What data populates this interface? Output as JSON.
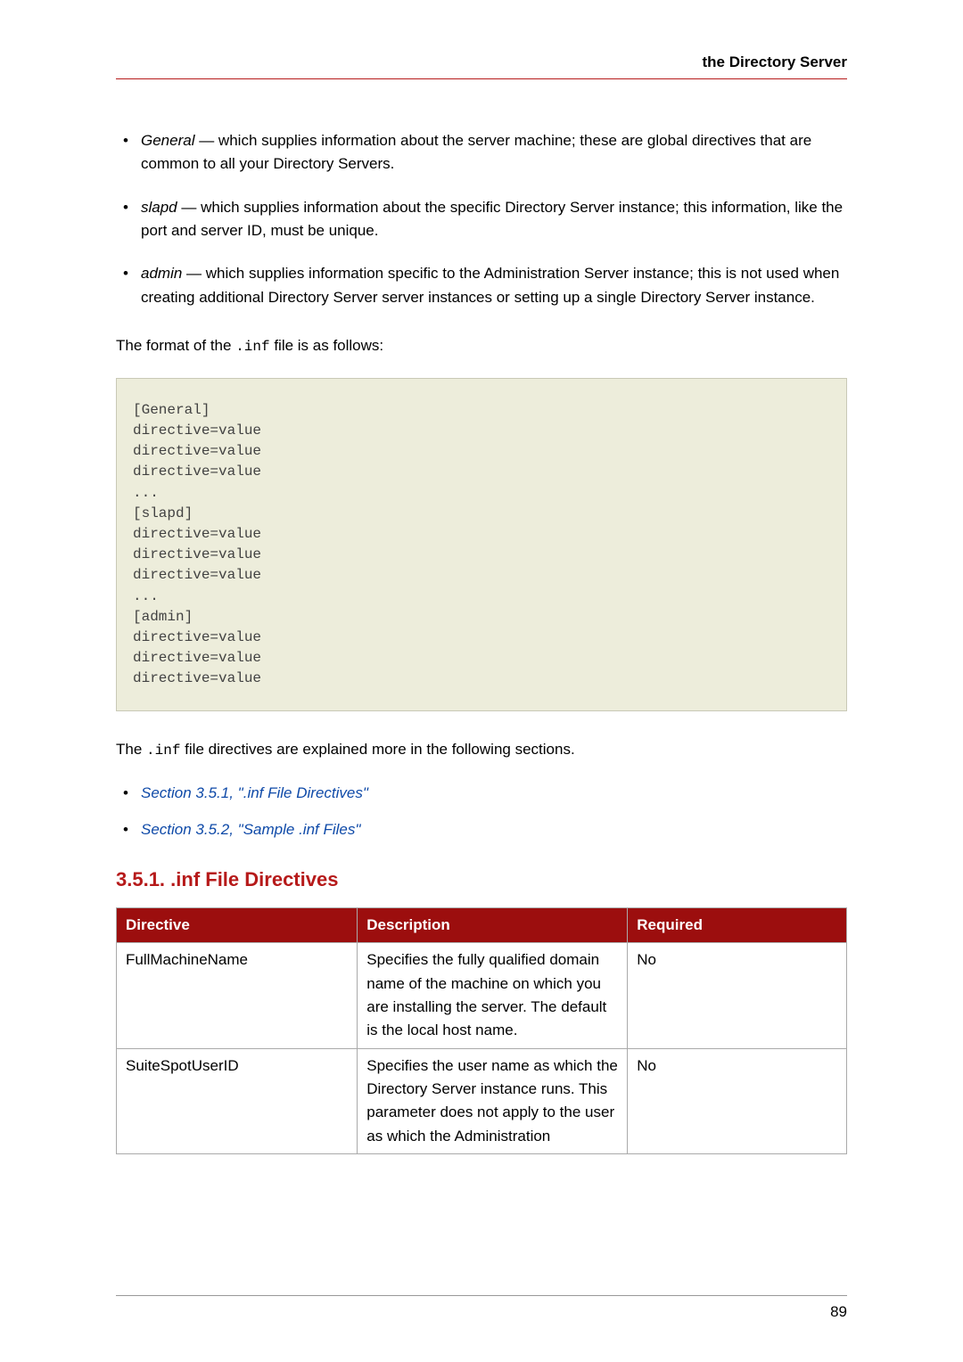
{
  "header": {
    "running_title": "the Directory Server"
  },
  "bullets": [
    {
      "term": "General",
      "text": " — which supplies information about the server machine; these are global directives that are common to all your Directory Servers."
    },
    {
      "term": "slapd",
      "text": " — which supplies information about the specific Directory Server instance; this information, like the port and server ID, must be unique."
    },
    {
      "term": "admin",
      "text": " — which supplies information specific to the Administration Server instance; this is not used when creating additional Directory Server server instances or setting up a single Directory Server instance."
    }
  ],
  "format_intro": {
    "before": "The format of the ",
    "code": ".inf",
    "after": " file is as follows:"
  },
  "codeblock": "[General]\ndirective=value\ndirective=value\ndirective=value\n...  \n[slapd]\ndirective=value\ndirective=value\ndirective=value\n...  \n[admin]\ndirective=value\ndirective=value\ndirective=value",
  "after_code": {
    "before": "The ",
    "code": ".inf",
    "after": " file directives are explained more in the following sections."
  },
  "links": [
    "Section 3.5.1, \".inf File Directives\"",
    "Section 3.5.2, \"Sample .inf Files\""
  ],
  "section_title": "3.5.1. .inf File Directives",
  "table": {
    "headers": [
      "Directive",
      "Description",
      "Required"
    ],
    "rows": [
      {
        "directive": "FullMachineName",
        "description": "Specifies the fully qualified domain name of the machine on which you are installing the server. The default is the local host name.",
        "required": "No"
      },
      {
        "directive": "SuiteSpotUserID",
        "description": "Specifies the user name as which the Directory Server instance runs. This parameter does not apply to the user as which the Administration",
        "required": "No"
      }
    ]
  },
  "page_number": "89"
}
